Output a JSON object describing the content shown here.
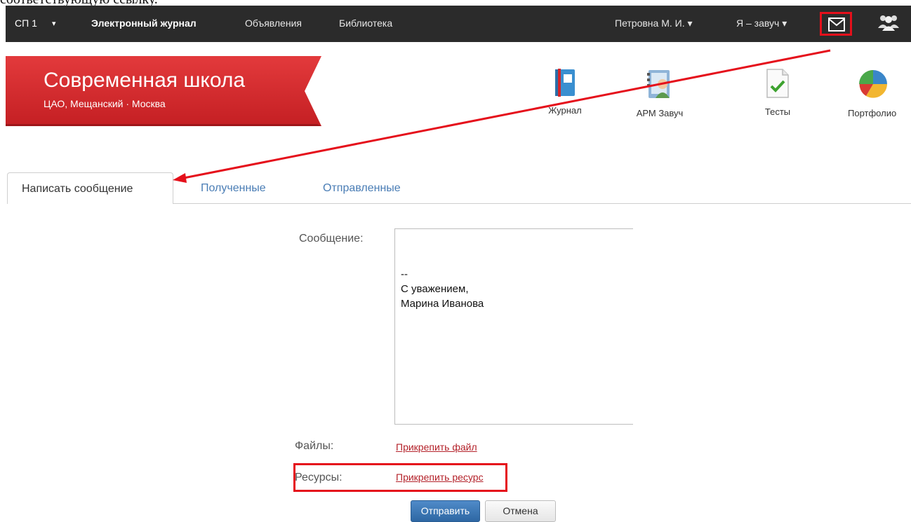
{
  "clipped_text": "соответствующую ссылку.",
  "topbar": {
    "sp": "СП 1",
    "sp_caret": "▾",
    "journal": "Электронный журнал",
    "announcements": "Объявления",
    "library": "Библиотека",
    "user": "Петровна М. И. ▾",
    "role": "Я – завуч ▾"
  },
  "header": {
    "school_name": "Современная школа",
    "school_location": "ЦАО, Мещанский · Москва"
  },
  "apps": [
    {
      "label": "Журнал",
      "icon": "journal-book-icon"
    },
    {
      "label": "АРМ Завуч",
      "icon": "head-teacher-icon"
    },
    {
      "label": "Тесты",
      "icon": "tests-checkmark-icon"
    },
    {
      "label": "Портфолио",
      "icon": "portfolio-pie-icon"
    }
  ],
  "tabs": [
    {
      "label": "Написать сообщение",
      "active": true
    },
    {
      "label": "Полученные",
      "active": false
    },
    {
      "label": "Отправленные",
      "active": false
    }
  ],
  "form": {
    "message_label": "Сообщение:",
    "message_lines": [
      "--",
      "С уважением,",
      "Марина Иванова"
    ],
    "files_label": "Файлы:",
    "attach_file": "Прикрепить файл",
    "resources_label": "Ресурсы:",
    "attach_resource": "Прикрепить ресурс",
    "send": "Отправить",
    "cancel": "Отмена"
  },
  "colors": {
    "topbar": "#2b2b2b",
    "ribbon": "#d52b2e",
    "annotation": "#e5101b",
    "link": "#b4222a",
    "tab_link": "#4a7db5",
    "primary_button": "#2e67a3"
  }
}
